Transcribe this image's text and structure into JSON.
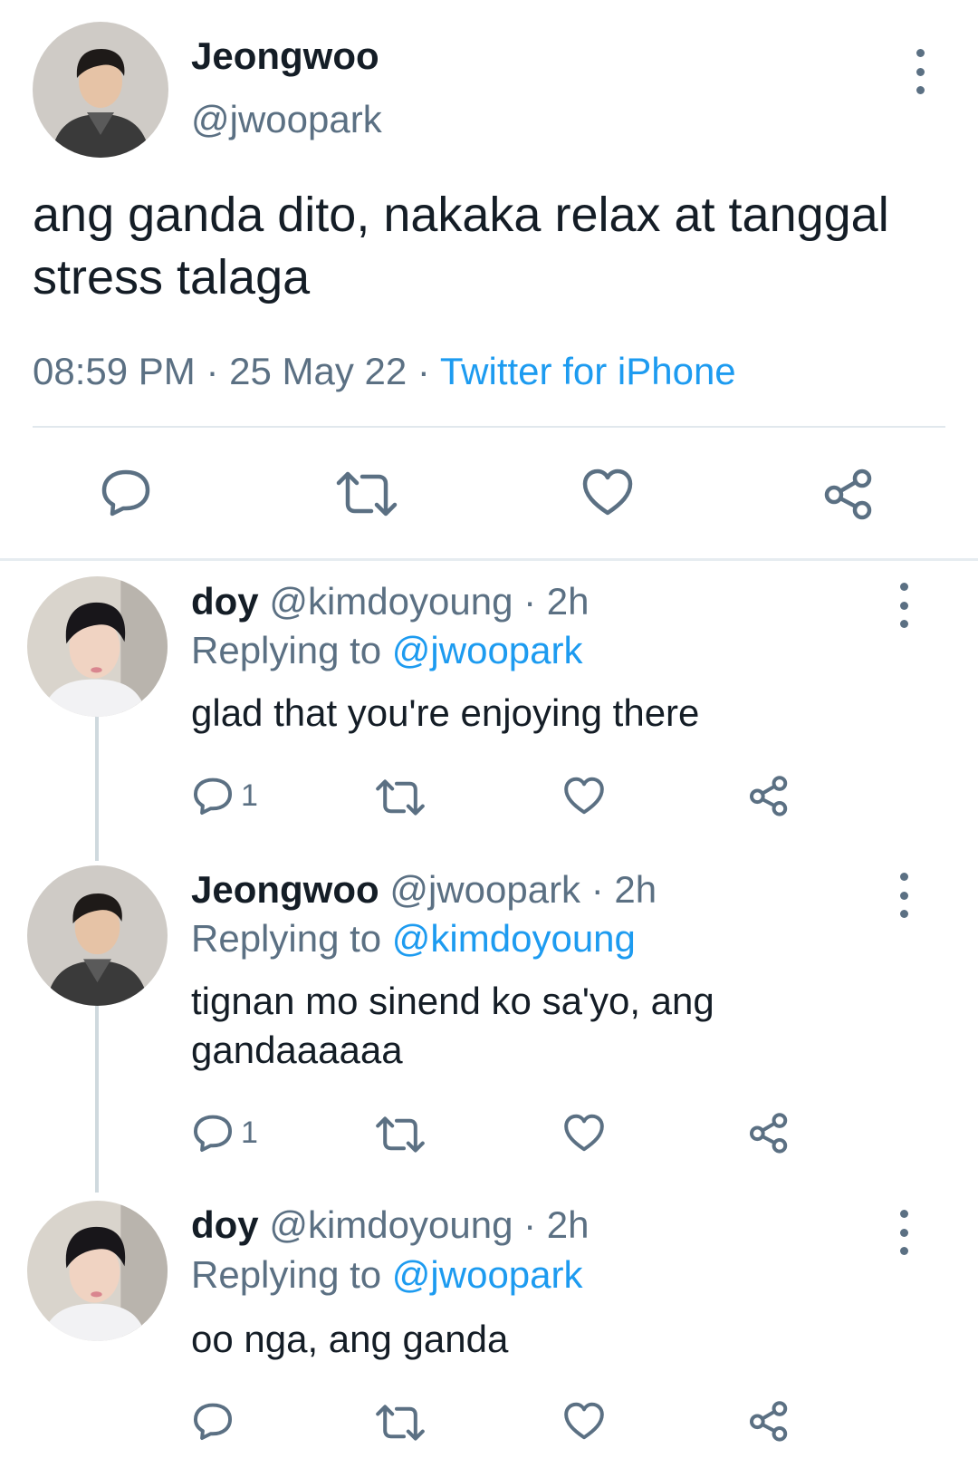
{
  "main_tweet": {
    "author_name": "Jeongwoo",
    "author_handle": "@jwoopark",
    "text": "ang ganda dito, nakaka relax at tanggal stress talaga",
    "time": "08:59 PM",
    "date": "25 May 22",
    "source": "Twitter for iPhone",
    "separator": "·"
  },
  "replies": [
    {
      "name": "doy",
      "handle": "@kimdoyoung",
      "time": "· 2h",
      "replying_label": "Replying to",
      "replying_to": "@jwoopark",
      "text": "glad that you're enjoying there",
      "reply_count": "1"
    },
    {
      "name": "Jeongwoo",
      "handle": "@jwoopark",
      "time": "· 2h",
      "replying_label": "Replying to",
      "replying_to": "@kimdoyoung",
      "text": "tignan mo sinend ko sa'yo, ang gandaaaaaa",
      "reply_count": "1"
    },
    {
      "name": "doy",
      "handle": "@kimdoyoung",
      "time": "· 2h",
      "replying_label": "Replying to",
      "replying_to": "@jwoopark",
      "text": "oo nga, ang ganda",
      "reply_count": ""
    }
  ],
  "icons": {
    "reply": "reply-icon",
    "retweet": "retweet-icon",
    "like": "heart-icon",
    "share": "share-icon",
    "more": "more-options-icon"
  },
  "colors": {
    "link": "#1d9bf0",
    "secondary_text": "#5b7083",
    "primary_text": "#141d26",
    "divider": "#e1e8ed"
  }
}
